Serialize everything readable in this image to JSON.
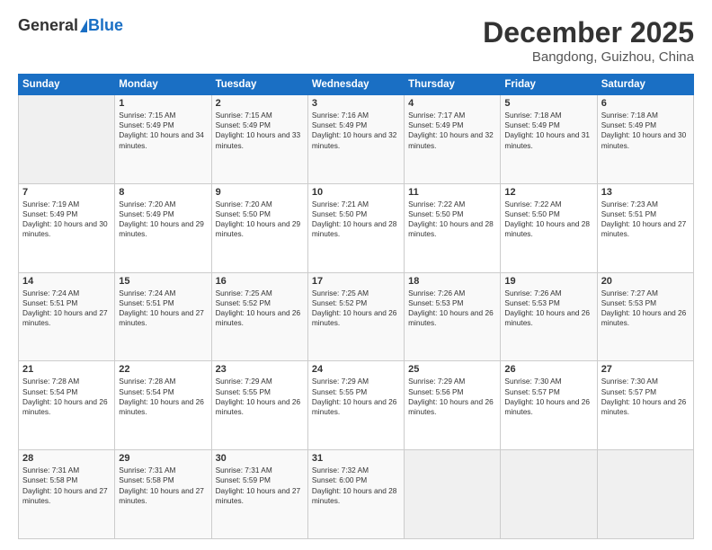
{
  "header": {
    "logo_general": "General",
    "logo_blue": "Blue",
    "month_year": "December 2025",
    "location": "Bangdong, Guizhou, China"
  },
  "days_of_week": [
    "Sunday",
    "Monday",
    "Tuesday",
    "Wednesday",
    "Thursday",
    "Friday",
    "Saturday"
  ],
  "weeks": [
    [
      {
        "day": "",
        "empty": true
      },
      {
        "day": "1",
        "sunrise": "7:15 AM",
        "sunset": "5:49 PM",
        "daylight": "10 hours and 34 minutes."
      },
      {
        "day": "2",
        "sunrise": "7:15 AM",
        "sunset": "5:49 PM",
        "daylight": "10 hours and 33 minutes."
      },
      {
        "day": "3",
        "sunrise": "7:16 AM",
        "sunset": "5:49 PM",
        "daylight": "10 hours and 32 minutes."
      },
      {
        "day": "4",
        "sunrise": "7:17 AM",
        "sunset": "5:49 PM",
        "daylight": "10 hours and 32 minutes."
      },
      {
        "day": "5",
        "sunrise": "7:18 AM",
        "sunset": "5:49 PM",
        "daylight": "10 hours and 31 minutes."
      },
      {
        "day": "6",
        "sunrise": "7:18 AM",
        "sunset": "5:49 PM",
        "daylight": "10 hours and 30 minutes."
      }
    ],
    [
      {
        "day": "7",
        "sunrise": "7:19 AM",
        "sunset": "5:49 PM",
        "daylight": "10 hours and 30 minutes."
      },
      {
        "day": "8",
        "sunrise": "7:20 AM",
        "sunset": "5:49 PM",
        "daylight": "10 hours and 29 minutes."
      },
      {
        "day": "9",
        "sunrise": "7:20 AM",
        "sunset": "5:50 PM",
        "daylight": "10 hours and 29 minutes."
      },
      {
        "day": "10",
        "sunrise": "7:21 AM",
        "sunset": "5:50 PM",
        "daylight": "10 hours and 28 minutes."
      },
      {
        "day": "11",
        "sunrise": "7:22 AM",
        "sunset": "5:50 PM",
        "daylight": "10 hours and 28 minutes."
      },
      {
        "day": "12",
        "sunrise": "7:22 AM",
        "sunset": "5:50 PM",
        "daylight": "10 hours and 28 minutes."
      },
      {
        "day": "13",
        "sunrise": "7:23 AM",
        "sunset": "5:51 PM",
        "daylight": "10 hours and 27 minutes."
      }
    ],
    [
      {
        "day": "14",
        "sunrise": "7:24 AM",
        "sunset": "5:51 PM",
        "daylight": "10 hours and 27 minutes."
      },
      {
        "day": "15",
        "sunrise": "7:24 AM",
        "sunset": "5:51 PM",
        "daylight": "10 hours and 27 minutes."
      },
      {
        "day": "16",
        "sunrise": "7:25 AM",
        "sunset": "5:52 PM",
        "daylight": "10 hours and 26 minutes."
      },
      {
        "day": "17",
        "sunrise": "7:25 AM",
        "sunset": "5:52 PM",
        "daylight": "10 hours and 26 minutes."
      },
      {
        "day": "18",
        "sunrise": "7:26 AM",
        "sunset": "5:53 PM",
        "daylight": "10 hours and 26 minutes."
      },
      {
        "day": "19",
        "sunrise": "7:26 AM",
        "sunset": "5:53 PM",
        "daylight": "10 hours and 26 minutes."
      },
      {
        "day": "20",
        "sunrise": "7:27 AM",
        "sunset": "5:53 PM",
        "daylight": "10 hours and 26 minutes."
      }
    ],
    [
      {
        "day": "21",
        "sunrise": "7:28 AM",
        "sunset": "5:54 PM",
        "daylight": "10 hours and 26 minutes."
      },
      {
        "day": "22",
        "sunrise": "7:28 AM",
        "sunset": "5:54 PM",
        "daylight": "10 hours and 26 minutes."
      },
      {
        "day": "23",
        "sunrise": "7:29 AM",
        "sunset": "5:55 PM",
        "daylight": "10 hours and 26 minutes."
      },
      {
        "day": "24",
        "sunrise": "7:29 AM",
        "sunset": "5:55 PM",
        "daylight": "10 hours and 26 minutes."
      },
      {
        "day": "25",
        "sunrise": "7:29 AM",
        "sunset": "5:56 PM",
        "daylight": "10 hours and 26 minutes."
      },
      {
        "day": "26",
        "sunrise": "7:30 AM",
        "sunset": "5:57 PM",
        "daylight": "10 hours and 26 minutes."
      },
      {
        "day": "27",
        "sunrise": "7:30 AM",
        "sunset": "5:57 PM",
        "daylight": "10 hours and 26 minutes."
      }
    ],
    [
      {
        "day": "28",
        "sunrise": "7:31 AM",
        "sunset": "5:58 PM",
        "daylight": "10 hours and 27 minutes."
      },
      {
        "day": "29",
        "sunrise": "7:31 AM",
        "sunset": "5:58 PM",
        "daylight": "10 hours and 27 minutes."
      },
      {
        "day": "30",
        "sunrise": "7:31 AM",
        "sunset": "5:59 PM",
        "daylight": "10 hours and 27 minutes."
      },
      {
        "day": "31",
        "sunrise": "7:32 AM",
        "sunset": "6:00 PM",
        "daylight": "10 hours and 28 minutes."
      },
      {
        "day": "",
        "empty": true
      },
      {
        "day": "",
        "empty": true
      },
      {
        "day": "",
        "empty": true
      }
    ]
  ]
}
